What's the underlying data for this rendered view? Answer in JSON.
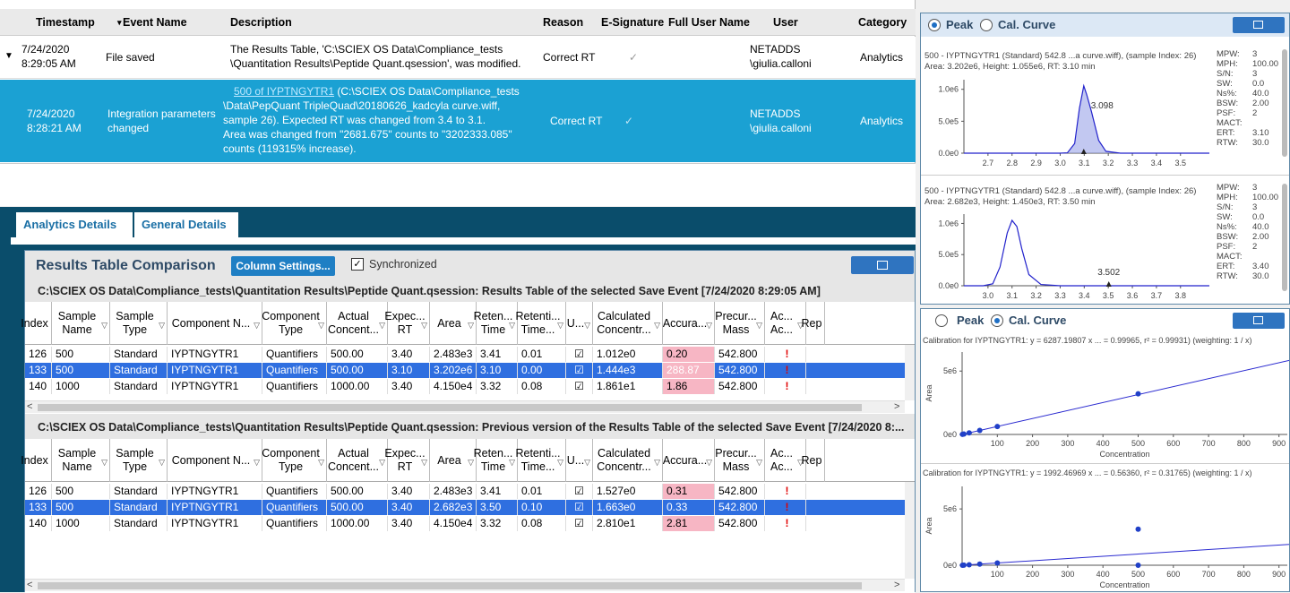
{
  "event_table": {
    "headers": [
      "Timestamp",
      "Event Name",
      "Description",
      "Reason",
      "E-Signature",
      "Full User Name",
      "User",
      "Category"
    ],
    "rows": [
      {
        "date": "7/24/2020",
        "time": "8:29:05 AM",
        "event": "File saved",
        "desc1": "The Results Table, 'C:\\SCIEX OS Data\\Compliance_tests",
        "desc2": "\\Quantitation Results\\Peptide Quant.qsession', was modified.",
        "reason": "Correct RT",
        "esig": "✓",
        "user1": "NETADDS",
        "user2": "\\giulia.calloni",
        "category": "Analytics"
      },
      {
        "date": "7/24/2020",
        "time": "8:28:21 AM",
        "event1": "Integration parameters",
        "event2": "changed",
        "desc_link": "500 of IYPTNGYTR1",
        "desc1": " (C:\\SCIEX OS Data\\Compliance_tests",
        "desc2": "\\Data\\PepQuant TripleQuad\\20180626_kadcyla curve.wiff,",
        "desc3": "sample 26). Expected RT was changed from 3.4 to 3.1.",
        "desc4": "Area was changed from \"2681.675\" counts to \"3202333.085\"",
        "desc5": "counts (119315% increase).",
        "reason": "Correct RT",
        "esig": "✓",
        "user1": "NETADDS",
        "user2": "\\giulia.calloni",
        "category": "Analytics"
      }
    ]
  },
  "tabs": [
    "Analytics Details",
    "General Details"
  ],
  "comparison": {
    "title": "Results Table Comparison",
    "column_settings": "Column Settings...",
    "synchronized": "Synchronized",
    "checkmark": "✓",
    "path1": "C:\\SCIEX OS Data\\Compliance_tests\\Quantitation Results\\Peptide Quant.qsession: Results Table of the selected Save Event [7/24/2020 8:29:05 AM]",
    "path2": "C:\\SCIEX OS Data\\Compliance_tests\\Quantitation Results\\Peptide Quant.qsession: Previous version of the Results Table of the selected Save Event [7/24/2020 8:...",
    "columns": [
      "Index",
      "Sample Name",
      "Sample Type",
      "Component N...",
      "Component Type",
      "Actual Concent...",
      "Expec... RT",
      "Area",
      "Reten... Time",
      "Retenti... Time...",
      "U...",
      "Calculated Concentr...",
      "Accura...",
      "Precur... Mass",
      "Ac... Ac...",
      "Rep"
    ],
    "table1": [
      [
        "126",
        "500",
        "Standard",
        "IYPTNGYTR1",
        "Quantifiers",
        "500.00",
        "3.40",
        "2.483e3",
        "3.41",
        "0.01",
        "☑",
        "1.012e0",
        "0.20",
        "542.800",
        "!"
      ],
      [
        "133",
        "500",
        "Standard",
        "IYPTNGYTR1",
        "Quantifiers",
        "500.00",
        "3.10",
        "3.202e6",
        "3.10",
        "0.00",
        "☑",
        "1.444e3",
        "288.87",
        "542.800",
        "!"
      ],
      [
        "140",
        "1000",
        "Standard",
        "IYPTNGYTR1",
        "Quantifiers",
        "1000.00",
        "3.40",
        "4.150e4",
        "3.32",
        "0.08",
        "☑",
        "1.861e1",
        "1.86",
        "542.800",
        "!"
      ]
    ],
    "table2": [
      [
        "126",
        "500",
        "Standard",
        "IYPTNGYTR1",
        "Quantifiers",
        "500.00",
        "3.40",
        "2.483e3",
        "3.41",
        "0.01",
        "☑",
        "1.527e0",
        "0.31",
        "542.800",
        "!"
      ],
      [
        "133",
        "500",
        "Standard",
        "IYPTNGYTR1",
        "Quantifiers",
        "500.00",
        "3.40",
        "2.682e3",
        "3.50",
        "0.10",
        "☑",
        "1.663e0",
        "0.33",
        "542.800",
        "!"
      ],
      [
        "140",
        "1000",
        "Standard",
        "IYPTNGYTR1",
        "Quantifiers",
        "1000.00",
        "3.40",
        "4.150e4",
        "3.32",
        "0.08",
        "☑",
        "2.810e1",
        "2.81",
        "542.800",
        "!"
      ]
    ],
    "selected_row": 1,
    "scroll_left": "<",
    "scroll_right": ">"
  },
  "peak_panel": {
    "radio_peak": "Peak",
    "radio_cal": "Cal. Curve",
    "chart1": {
      "line1": "500 - IYPTNGYTR1 (Standard) 542.8 ...a curve.wiff), (sample Index: 26)",
      "line2": "Area: 3.202e6, Height: 1.055e6, RT: 3.10 min",
      "peak_label": "3.098",
      "stats": [
        [
          "MPW:",
          "3"
        ],
        [
          "MPH:",
          "100.00"
        ],
        [
          "S/N:",
          "3"
        ],
        [
          "SW:",
          "0.0"
        ],
        [
          "Ns%:",
          "40.0"
        ],
        [
          "BSW:",
          "2.00"
        ],
        [
          "PSF:",
          "2"
        ],
        [
          "MACT:",
          ""
        ],
        [
          "ERT:",
          "3.10"
        ],
        [
          "RTW:",
          "30.0"
        ]
      ]
    },
    "chart2": {
      "line1": "500 - IYPTNGYTR1 (Standard) 542.8 ...a curve.wiff), (sample Index: 26)",
      "line2": "Area: 2.682e3, Height: 1.450e3, RT: 3.50 min",
      "peak_label": "3.502",
      "stats": [
        [
          "MPW:",
          "3"
        ],
        [
          "MPH:",
          "100.00"
        ],
        [
          "S/N:",
          "3"
        ],
        [
          "SW:",
          "0.0"
        ],
        [
          "Ns%:",
          "40.0"
        ],
        [
          "BSW:",
          "2.00"
        ],
        [
          "PSF:",
          "2"
        ],
        [
          "MACT:",
          ""
        ],
        [
          "ERT:",
          "3.40"
        ],
        [
          "RTW:",
          "30.0"
        ]
      ]
    }
  },
  "cal_panel": {
    "radio_peak": "Peak",
    "radio_cal": "Cal. Curve",
    "cal1_label": "Calibration for IYPTNGYTR1: y = 6287.19807 x ... = 0.99965, r² = 0.99931)  (weighting: 1 / x)",
    "cal2_label": "Calibration for IYPTNGYTR1: y = 1992.46969 x ... = 0.56360, r² = 0.31765)  (weighting: 1 / x)"
  },
  "chart_data": [
    {
      "type": "line",
      "x_ticks": [
        "2.7",
        "2.8",
        "2.9",
        "3.0",
        "3.1",
        "3.2",
        "3.3",
        "3.4",
        "3.5"
      ],
      "y_ticks": [
        "0.0e0",
        "5.0e5",
        "1.0e6"
      ],
      "xlim": [
        2.6,
        3.62
      ],
      "ylim": [
        0,
        1150000
      ],
      "series": [
        {
          "x": [
            2.6,
            3.0,
            3.03,
            3.06,
            3.08,
            3.098,
            3.11,
            3.13,
            3.16,
            3.19,
            3.25,
            3.62
          ],
          "y": [
            0,
            0,
            5000,
            150000,
            700000,
            1055000,
            920000,
            650000,
            200000,
            30000,
            0,
            0
          ]
        }
      ],
      "annotation": {
        "x": 3.098,
        "label": "3.098"
      }
    },
    {
      "type": "line",
      "x_ticks": [
        "3.0",
        "3.1",
        "3.2",
        "3.3",
        "3.4",
        "3.5",
        "3.6",
        "3.7",
        "3.8"
      ],
      "y_ticks": [
        "0.0e0",
        "5.0e5",
        "1.0e6"
      ],
      "xlim": [
        2.9,
        3.92
      ],
      "ylim": [
        0,
        1150000
      ],
      "series": [
        {
          "x": [
            2.9,
            2.98,
            3.02,
            3.05,
            3.08,
            3.1,
            3.12,
            3.14,
            3.17,
            3.22,
            3.3,
            3.92
          ],
          "y": [
            0,
            0,
            30000,
            300000,
            850000,
            1050000,
            950000,
            600000,
            180000,
            20000,
            0,
            0
          ]
        }
      ],
      "annotation": {
        "x": 3.502,
        "label": "3.502"
      }
    },
    {
      "type": "scatter",
      "xlabel": "Concentration",
      "ylabel": "Area",
      "x_ticks": [
        "100",
        "200",
        "300",
        "400",
        "500",
        "600",
        "700",
        "800",
        "900"
      ],
      "y_ticks": [
        "0e0",
        "5e6"
      ],
      "xlim": [
        0,
        1000
      ],
      "ylim": [
        0,
        6500000
      ],
      "points": [
        [
          1,
          6287
        ],
        [
          5,
          31000
        ],
        [
          20,
          125000
        ],
        [
          50,
          315000
        ],
        [
          100,
          630000
        ],
        [
          500,
          3202000
        ],
        [
          1000,
          6287000
        ]
      ],
      "fit": {
        "slope": 6287.19807
      }
    },
    {
      "type": "scatter",
      "xlabel": "Concentration",
      "ylabel": "Area",
      "x_ticks": [
        "100",
        "200",
        "300",
        "400",
        "500",
        "600",
        "700",
        "800",
        "900"
      ],
      "y_ticks": [
        "0e0",
        "5e6"
      ],
      "xlim": [
        0,
        1000
      ],
      "ylim": [
        0,
        7000000
      ],
      "points": [
        [
          1,
          2000
        ],
        [
          5,
          10000
        ],
        [
          20,
          40000
        ],
        [
          50,
          100000
        ],
        [
          100,
          200000
        ],
        [
          500,
          3202000
        ],
        [
          500,
          2682
        ],
        [
          1000,
          6287000
        ]
      ],
      "fit": {
        "slope": 1992.46969
      }
    }
  ]
}
